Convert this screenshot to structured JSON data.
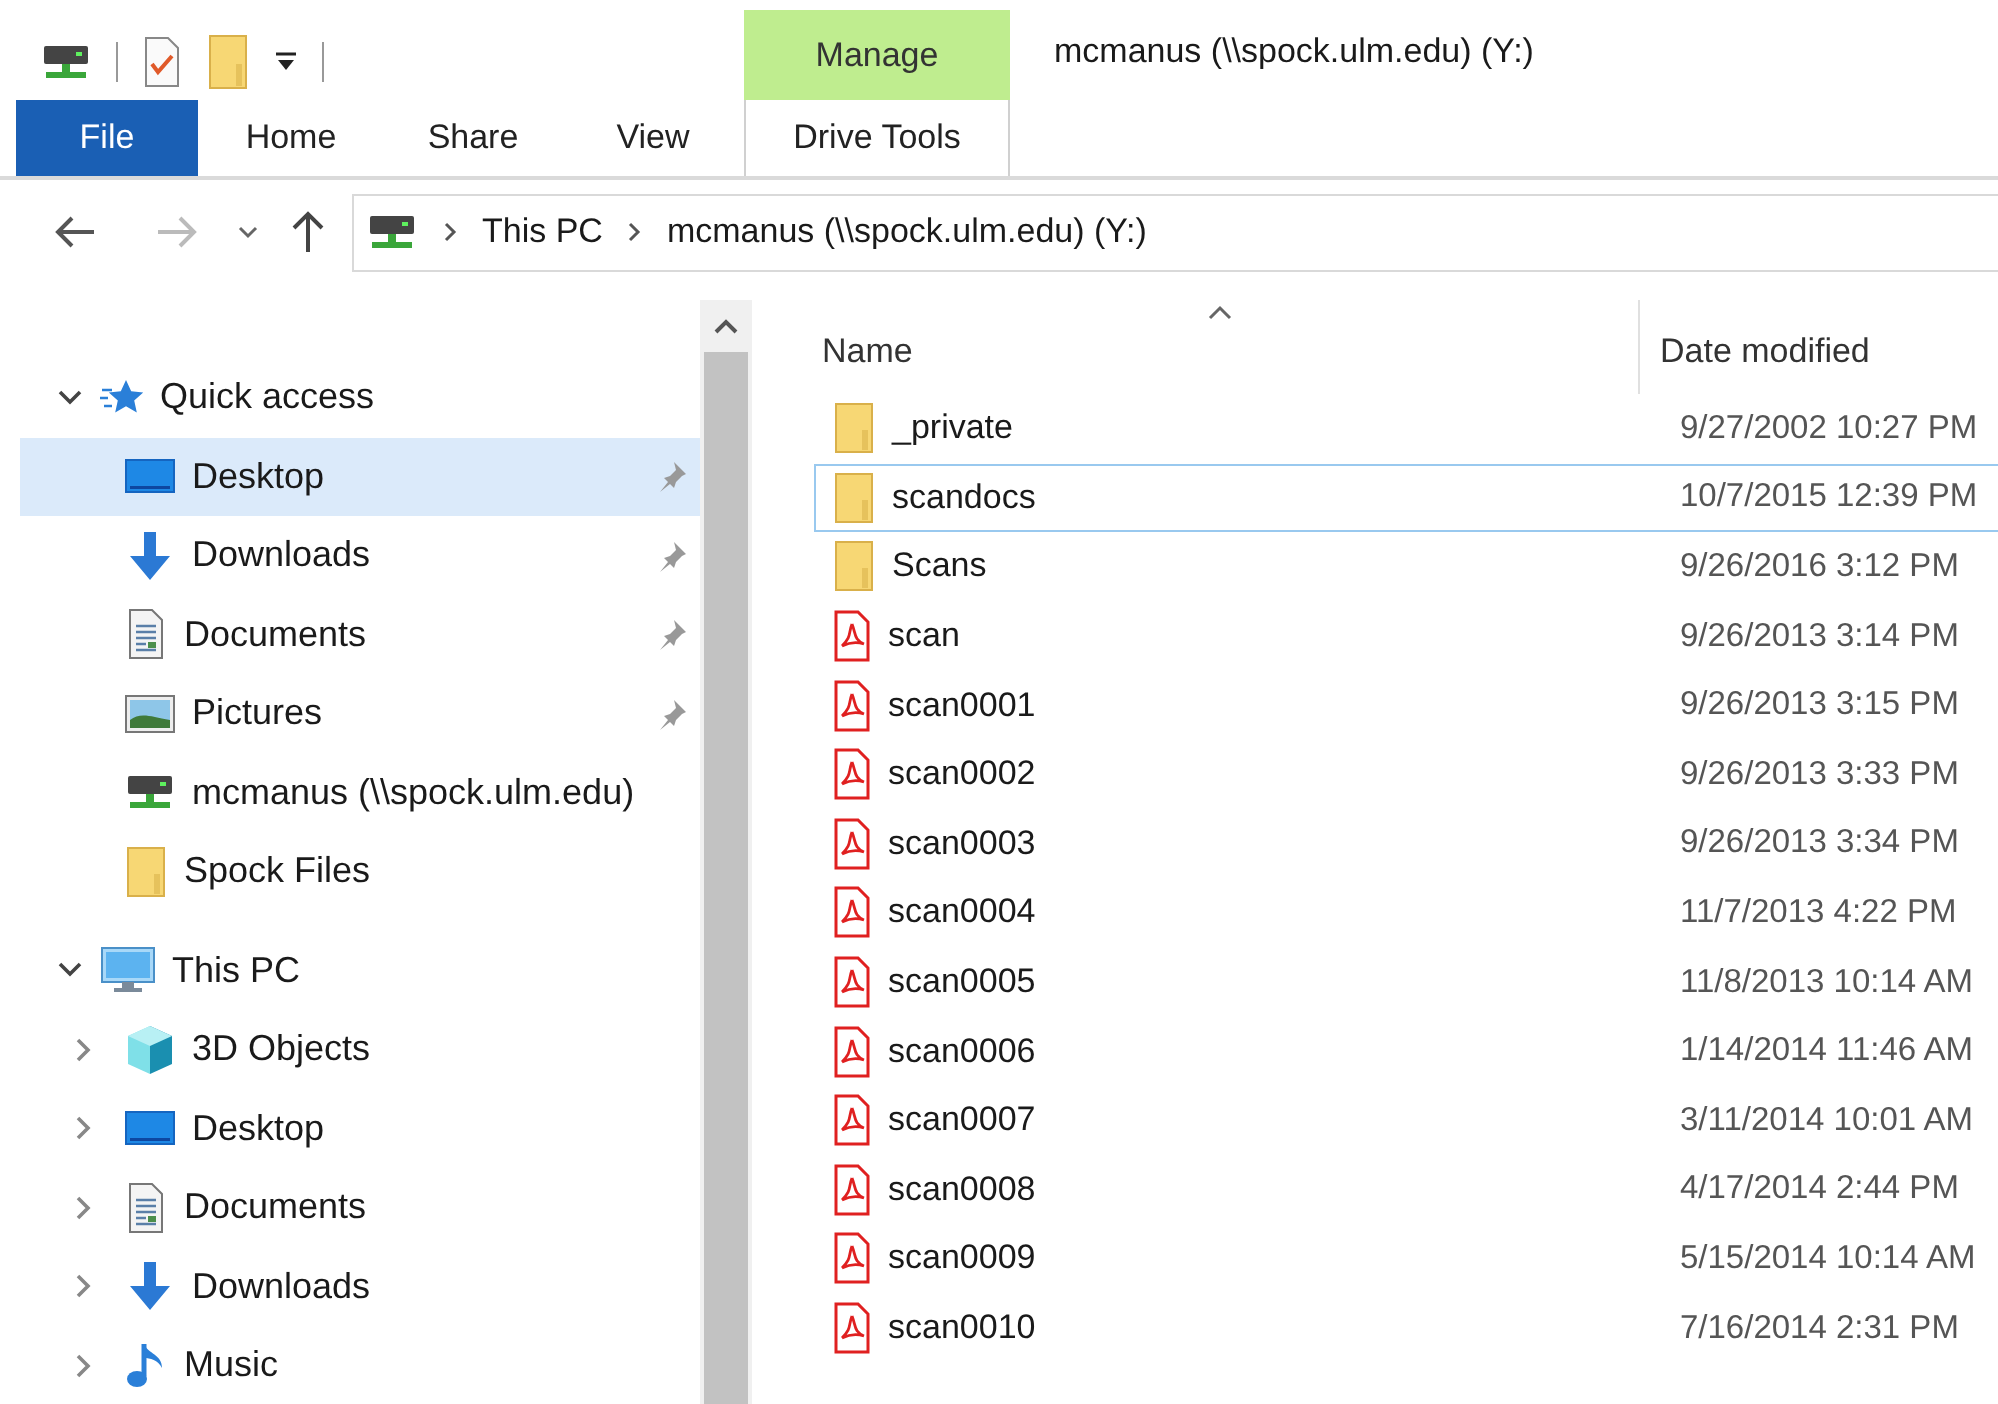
{
  "window": {
    "title": "mcmanus (\\\\spock.ulm.edu) (Y:)"
  },
  "ribbon": {
    "context_group": "Manage",
    "tabs": [
      {
        "label": "File",
        "kind": "file"
      },
      {
        "label": "Home",
        "kind": "tab"
      },
      {
        "label": "Share",
        "kind": "tab"
      },
      {
        "label": "View",
        "kind": "tab"
      },
      {
        "label": "Drive Tools",
        "kind": "context"
      }
    ]
  },
  "address": {
    "path": [
      "This PC",
      "mcmanus (\\\\spock.ulm.edu) (Y:)"
    ]
  },
  "navigation": [
    {
      "label": "Quick access",
      "kind": "quick",
      "expanded": true,
      "selected": false,
      "children": [
        {
          "label": "Desktop",
          "kind": "desktop",
          "pinned": true,
          "selected": true
        },
        {
          "label": "Downloads",
          "kind": "downloads",
          "pinned": true,
          "selected": false
        },
        {
          "label": "Documents",
          "kind": "documents",
          "pinned": true,
          "selected": false
        },
        {
          "label": "Pictures",
          "kind": "pictures",
          "pinned": true,
          "selected": false
        },
        {
          "label": "mcmanus (\\\\spock.ulm.edu)",
          "kind": "drive",
          "pinned": false,
          "selected": false
        },
        {
          "label": "Spock Files",
          "kind": "folder",
          "pinned": false,
          "selected": false
        }
      ]
    },
    {
      "label": "This PC",
      "kind": "pc",
      "expanded": true,
      "selected": false,
      "children": [
        {
          "label": "3D Objects",
          "kind": "cube",
          "expanded": false,
          "selected": false
        },
        {
          "label": "Desktop",
          "kind": "desktop",
          "expanded": false,
          "selected": false
        },
        {
          "label": "Documents",
          "kind": "documents",
          "expanded": false,
          "selected": false
        },
        {
          "label": "Downloads",
          "kind": "downloads",
          "expanded": false,
          "selected": false
        },
        {
          "label": "Music",
          "kind": "music",
          "expanded": false,
          "selected": false
        }
      ]
    }
  ],
  "columns": [
    {
      "label": "Name",
      "sorted": true
    },
    {
      "label": "Date modified",
      "sorted": false
    }
  ],
  "files": [
    {
      "name": "_private",
      "kind": "folder",
      "date": "9/27/2002 10:27 PM",
      "focused": false
    },
    {
      "name": "scandocs",
      "kind": "folder",
      "date": "10/7/2015 12:39 PM",
      "focused": true
    },
    {
      "name": "Scans",
      "kind": "folder",
      "date": "9/26/2016 3:12 PM",
      "focused": false
    },
    {
      "name": "scan",
      "kind": "pdf",
      "date": "9/26/2013 3:14 PM",
      "focused": false
    },
    {
      "name": "scan0001",
      "kind": "pdf",
      "date": "9/26/2013 3:15 PM",
      "focused": false
    },
    {
      "name": "scan0002",
      "kind": "pdf",
      "date": "9/26/2013 3:33 PM",
      "focused": false
    },
    {
      "name": "scan0003",
      "kind": "pdf",
      "date": "9/26/2013 3:34 PM",
      "focused": false
    },
    {
      "name": "scan0004",
      "kind": "pdf",
      "date": "11/7/2013 4:22 PM",
      "focused": false
    },
    {
      "name": "scan0005",
      "kind": "pdf",
      "date": "11/8/2013 10:14 AM",
      "focused": false
    },
    {
      "name": "scan0006",
      "kind": "pdf",
      "date": "1/14/2014 11:46 AM",
      "focused": false
    },
    {
      "name": "scan0007",
      "kind": "pdf",
      "date": "3/11/2014 10:01 AM",
      "focused": false
    },
    {
      "name": "scan0008",
      "kind": "pdf",
      "date": "4/17/2014 2:44 PM",
      "focused": false
    },
    {
      "name": "scan0009",
      "kind": "pdf",
      "date": "5/15/2014 10:14 AM",
      "focused": false
    },
    {
      "name": "scan0010",
      "kind": "pdf",
      "date": "7/16/2014 2:31 PM",
      "focused": false
    }
  ]
}
